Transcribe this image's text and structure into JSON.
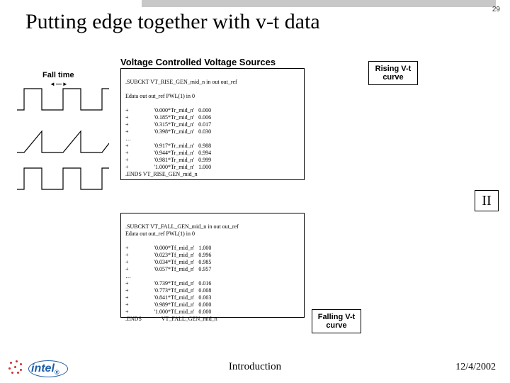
{
  "page_number": "29",
  "title": "Putting edge together with v-t data",
  "section_heading": "Voltage Controlled Voltage Sources",
  "fall_time_label": "Fall time",
  "rising_box": "Rising V-t\ncurve",
  "falling_box": "Falling V-t\ncurve",
  "big_symbol": "II",
  "code1": {
    "l1": ".SUBCKT VT_RISE_GEN_mid_n in out out_ref",
    "l2": "Edata out out_ref PWL(1) in 0",
    "r": [
      {
        "a": "+",
        "b": "'0.000*Tr_mid_n'",
        "c": "0.000"
      },
      {
        "a": "+",
        "b": "'0.185*Tr_mid_n'",
        "c": "0.006"
      },
      {
        "a": "+",
        "b": "'0.315*Tr_mid_n'",
        "c": "0.017"
      },
      {
        "a": "+",
        "b": "'0.398*Tr_mid_n'",
        "c": "0.030"
      }
    ],
    "dots": "…",
    "r2": [
      {
        "a": "+",
        "b": "'0.917*Tr_mid_n'",
        "c": "0.988"
      },
      {
        "a": "+",
        "b": "'0.944*Tr_mid_n'",
        "c": "0.994"
      },
      {
        "a": "+",
        "b": "'0.981*Tr_mid_n'",
        "c": "0.999"
      },
      {
        "a": "+",
        "b": "'1.000*Tr_mid_n'",
        "c": "1.000"
      }
    ],
    "end": ".ENDS VT_RISE_GEN_mid_n"
  },
  "code2": {
    "l1": ".SUBCKT VT_FALL_GEN_mid_n in out out_ref",
    "l2": "Edata out out_ref PWL(1) in 0",
    "r": [
      {
        "a": "+",
        "b": "'0.000*Tf_mid_n'",
        "c": "1.000"
      },
      {
        "a": "+",
        "b": "'0.023*Tf_mid_n'",
        "c": "0.996"
      },
      {
        "a": "+",
        "b": "'0.034*Tf_mid_n'",
        "c": "0.985"
      },
      {
        "a": "+",
        "b": "'0.057*Tf_mid_n'",
        "c": "0.957"
      }
    ],
    "dots": "…",
    "r2": [
      {
        "a": "+",
        "b": "'0.739*Tf_mid_n'",
        "c": "0.016"
      },
      {
        "a": "+",
        "b": "'0.773*Tf_mid_n'",
        "c": "0.008"
      },
      {
        "a": "+",
        "b": "'0.841*Tf_mid_n'",
        "c": "0.003"
      },
      {
        "a": "+",
        "b": "'0.989*Tf_mid_n'",
        "c": "0.000"
      },
      {
        "a": "+",
        "b": "'1.000*Tf_mid_n'",
        "c": "0.000"
      }
    ],
    "end": ".ENDS",
    "end2": "VT_FALL_GEN_mid_n"
  },
  "footer": {
    "center": "Introduction",
    "date": "12/4/2002",
    "logo_text": "intel"
  }
}
